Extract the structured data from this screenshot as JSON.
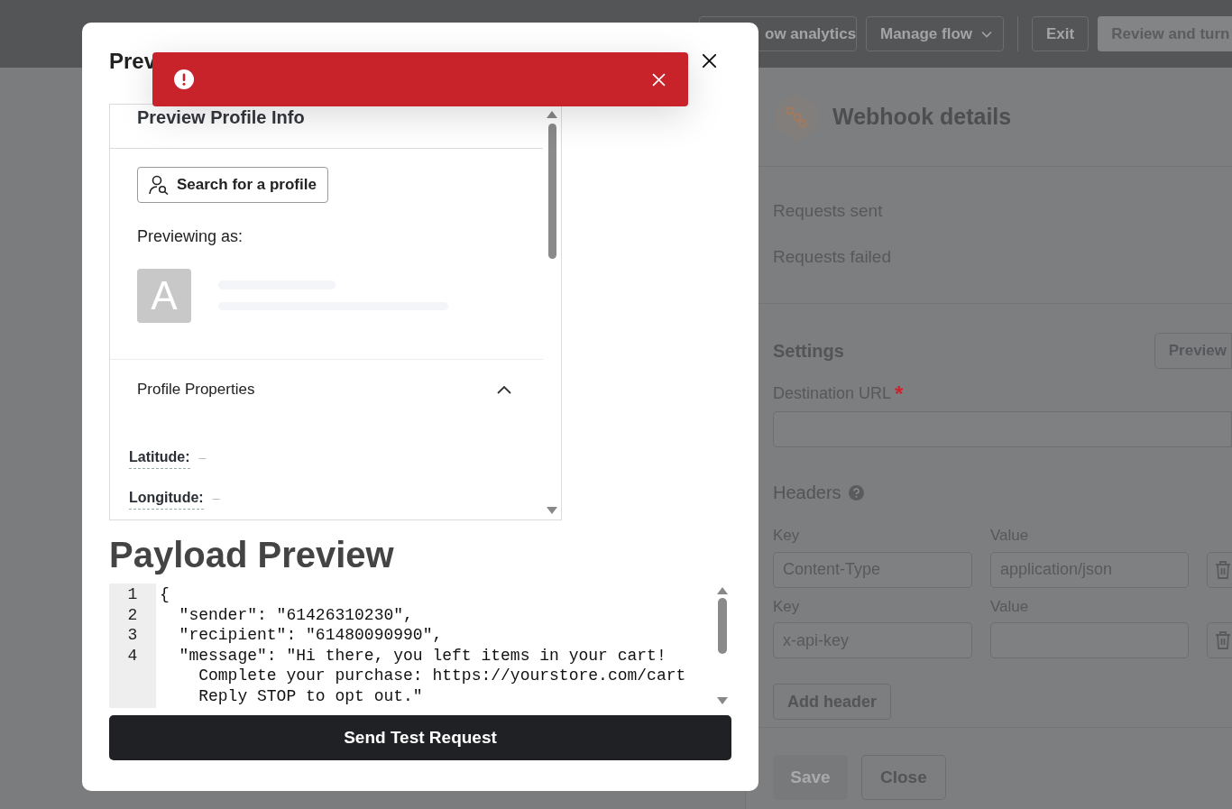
{
  "top_bar": {
    "buttons": [
      {
        "label": "ow analytics",
        "kind": "outline"
      },
      {
        "label": "Manage flow",
        "kind": "dropdown"
      },
      {
        "label": "Exit",
        "kind": "outline"
      },
      {
        "label": "Review and turn",
        "kind": "filled"
      }
    ]
  },
  "webhook_panel": {
    "title": "Webhook details",
    "stats": [
      "Requests sent",
      "Requests failed"
    ],
    "settings": {
      "title": "Settings",
      "preview_button": "Preview",
      "destination_url": {
        "label": "Destination URL",
        "required_mark": "*"
      },
      "headers_label": "Headers",
      "headers": [
        {
          "key_label": "Key",
          "key": "Content-Type",
          "value_label": "Value",
          "value": "application/json"
        },
        {
          "key_label": "Key",
          "key": "x-api-key",
          "value_label": "Value"
        }
      ],
      "add_header": "Add header"
    },
    "footer": [
      {
        "label": "Save",
        "disabled": true
      },
      {
        "label": "Close",
        "disabled": false
      }
    ]
  },
  "modal": {
    "title": "Prev",
    "toast": {
      "kind": "error"
    },
    "profile": {
      "title": "Preview Profile Info",
      "search_button": "Search for a profile",
      "previewing_label": "Previewing as:",
      "avatar_letter": "A",
      "properties": {
        "title": "Profile Properties",
        "expanded": true,
        "items": [
          {
            "label": "Latitude:",
            "value": "–"
          },
          {
            "label": "Longitude:",
            "value": "–"
          }
        ]
      }
    },
    "payload": {
      "title": "Payload Preview",
      "lines": [
        {
          "number": "1",
          "text": "{"
        },
        {
          "number": "2",
          "text": "  \"sender\": \"61426310230\","
        },
        {
          "number": "3",
          "text": "  \"recipient\": \"61480090990\","
        },
        {
          "number": "4",
          "text": "  \"message\": \"Hi there, you left items in your cart!",
          "continuation": [
            "    Complete your purchase: https://yourstore.com/cart",
            "    Reply STOP to opt out.\""
          ]
        }
      ]
    },
    "send_button": "Send Test Request"
  }
}
